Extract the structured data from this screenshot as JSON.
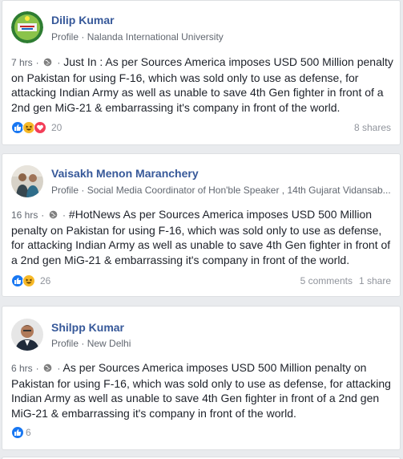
{
  "posts": [
    {
      "author": "Dilip Kumar",
      "profile_label": "Profile",
      "subtitle": "Nalanda International University",
      "time": "7 hrs",
      "text": "Just In : As per Sources America imposes USD 500 Million penalty on Pakistan for using F-16, which was sold only to use as defense, for attacking Indian Army as well as unable to save 4th Gen fighter in front of a 2nd gen MiG-21 & embarrassing it's company in front of the world.",
      "reactions": [
        "like-icon",
        "haha-icon",
        "love-icon"
      ],
      "reaction_count": "20",
      "comments": "",
      "shares": "8 shares"
    },
    {
      "author": "Vaisakh Menon Maranchery",
      "profile_label": "Profile",
      "subtitle": "Social Media Coordinator of Hon'ble Speaker , 14th Gujarat Vidansab...",
      "time": "16 hrs",
      "text": "#HotNews As per Sources America imposes USD 500 Million penalty on Pakistan for using F-16, which was sold only to use as defense, for attacking Indian Army as well as unable to save 4th Gen fighter in front of a 2nd gen MiG-21 & embarrassing it's company in front of the world.",
      "reactions": [
        "like-icon",
        "haha-icon"
      ],
      "reaction_count": "26",
      "comments": "5 comments",
      "shares": "1 share"
    },
    {
      "author": "Shilpp Kumar",
      "profile_label": "Profile",
      "subtitle": "New Delhi",
      "time": "6 hrs",
      "text": "As per Sources America imposes USD 500 Million penalty on Pakistan for using F-16, which was sold only to use as defense, for attacking Indian Army as well as unable to save 4th Gen fighter in front of a 2nd gen MiG-21 & embarrassing it's company in front of the world.",
      "reactions": [
        "like-icon"
      ],
      "reaction_count": "6",
      "comments": "",
      "shares": ""
    }
  ],
  "colors": {
    "background": "#e9ebee",
    "name_link": "#365899",
    "secondary_text": "#616770",
    "like_blue": "#1877f2",
    "haha_yellow": "#f7b928",
    "love_red": "#f33e58"
  },
  "separator": "·"
}
